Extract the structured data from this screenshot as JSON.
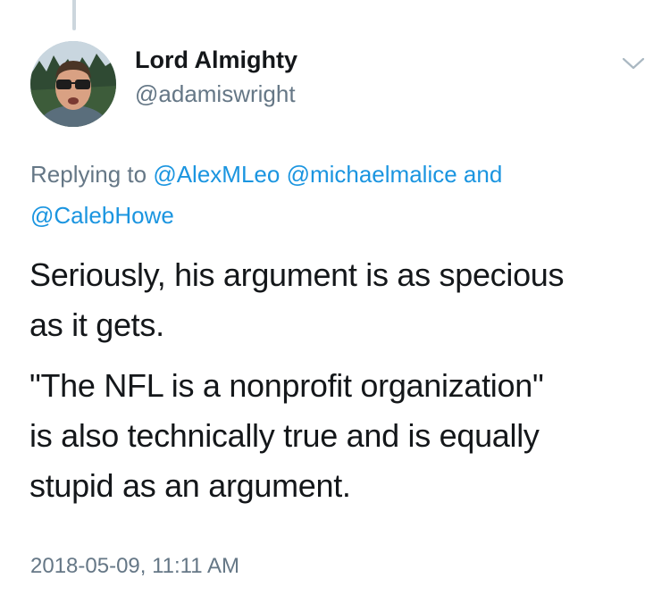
{
  "tweet": {
    "author": {
      "name": "Lord Almighty",
      "handle": "@adamiswright"
    },
    "replying": {
      "prefix": "Replying to",
      "mentions": [
        "@AlexMLeo",
        "@michaelmalice",
        "@CalebHowe"
      ],
      "conjunction": "and"
    },
    "paragraphs": [
      "Seriously, his argument is as specious\nas it gets.",
      "\"The NFL is a nonprofit organization\"\nis also technically true and is equally\nstupid as an argument."
    ],
    "timestamp": "2018-05-09, 11:11 AM"
  },
  "icons": {
    "menu": "chevron-down-icon",
    "avatar": "profile-photo"
  },
  "colors": {
    "text_primary": "#14171a",
    "text_secondary": "#657786",
    "link": "#1b95e0",
    "thread_line": "#ccd6dd"
  }
}
